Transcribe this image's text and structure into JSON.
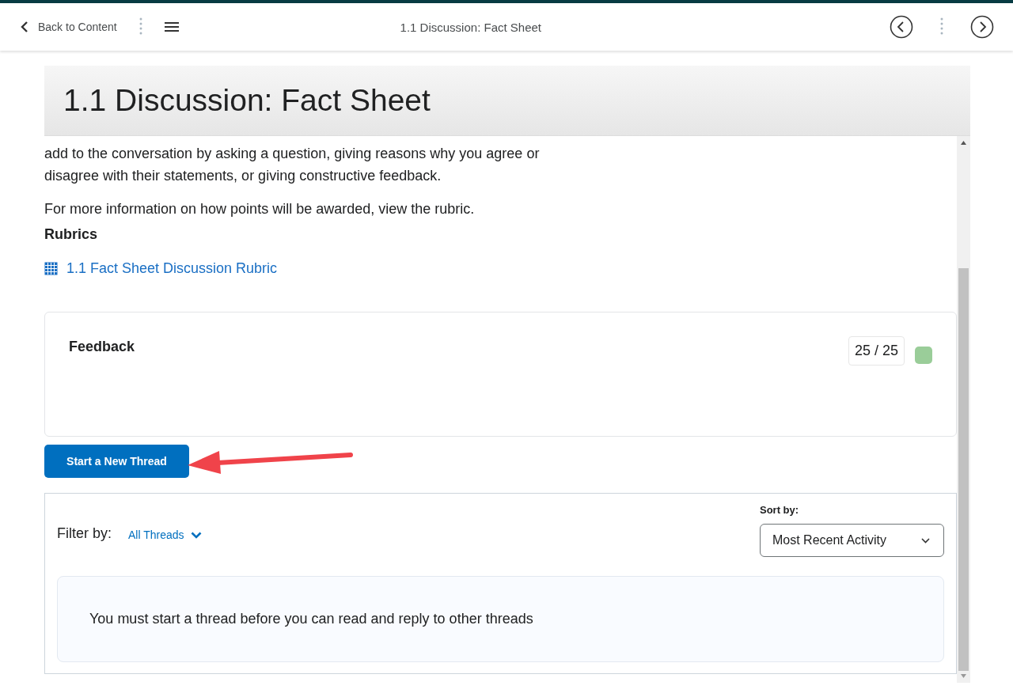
{
  "top_bar": {
    "back_label": "Back to Content",
    "title": "1.1 Discussion: Fact Sheet"
  },
  "page_title": "1.1 Discussion: Fact Sheet",
  "paragraphs": [
    "add to the conversation by asking a question, giving reasons why you agree or disagree with their statements, or giving constructive feedback.",
    "For more information on how points will be awarded, view the rubric."
  ],
  "rubrics": {
    "heading": "Rubrics",
    "link": "1.1 Fact Sheet Discussion Rubric"
  },
  "feedback": {
    "heading": "Feedback",
    "score": "25 / 25"
  },
  "start_button": "Start a New Thread",
  "threads": {
    "filter_label": "Filter by:",
    "filter_value": "All Threads",
    "sort_label": "Sort by:",
    "sort_value": "Most Recent Activity",
    "notice": "You must start a thread before you can read and reply to other threads"
  }
}
